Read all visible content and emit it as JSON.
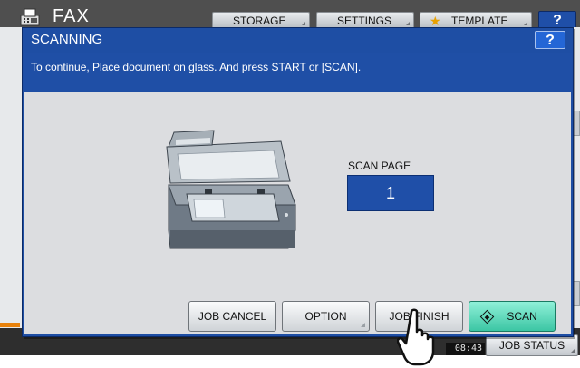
{
  "background": {
    "app_title": "FAX",
    "tabs": [
      {
        "label": "STORAGE"
      },
      {
        "label": "SETTINGS"
      },
      {
        "label": "TEMPLATE"
      }
    ],
    "help_label": "?",
    "clock": "08:43",
    "job_status_label": "JOB STATUS"
  },
  "dialog": {
    "title": "SCANNING",
    "help_label": "?",
    "message": "To continue, Place document on glass. And press START or [SCAN].",
    "scan_page_label": "SCAN PAGE",
    "scan_page_count": "1",
    "buttons": {
      "job_cancel": "JOB CANCEL",
      "option": "OPTION",
      "job_finish": "JOB FINISH",
      "scan": "SCAN"
    }
  },
  "icons": {
    "fax": "fax-icon",
    "star": "star-icon",
    "scanner": "scanner-illustration",
    "scan_start": "diamond-start-icon",
    "pointer": "hand-pointer-icon"
  },
  "colors": {
    "dialog_blue": "#1e4ea4",
    "scan_button": "#3cc6a4",
    "accent_orange": "#e8820c"
  }
}
